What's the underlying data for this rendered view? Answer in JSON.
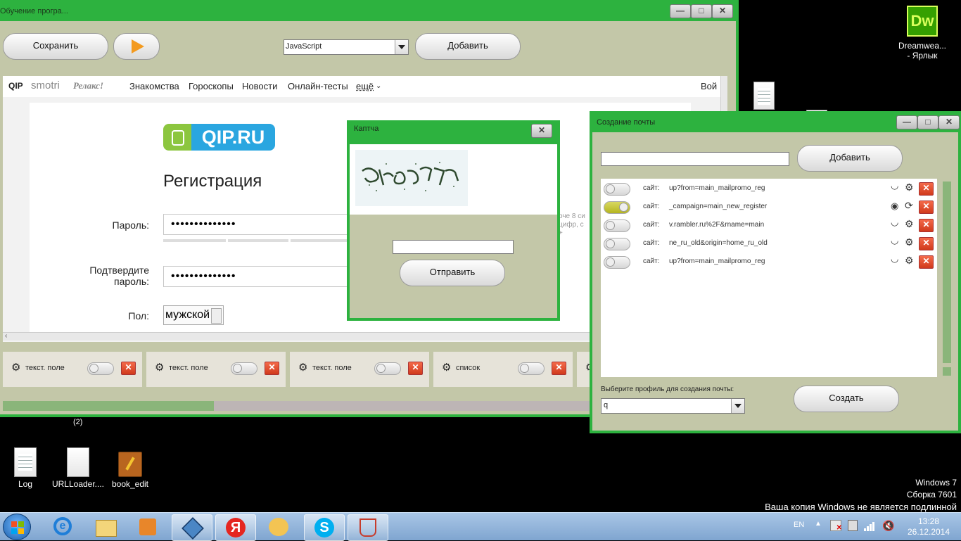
{
  "desktop": {
    "icons": [
      {
        "label": "Log"
      },
      {
        "label": "URLLoader...."
      },
      {
        "label": "book_edit"
      },
      {
        "label": "Dreamwea...\n- Ярлык",
        "logo": "Dw"
      }
    ],
    "counter": "(2)",
    "watermark": {
      "line1": "Windows 7",
      "line2": "Сборка 7601",
      "line3": "Ваша копия Windows не является подлинной"
    }
  },
  "main_window": {
    "title": "Обучение програ...",
    "save_label": "Сохранить",
    "language_select": "JavaScript",
    "add_label": "Добавить",
    "progress": 0.29
  },
  "browser": {
    "nav": {
      "brand1": "QIP",
      "brand2": "smotri",
      "brand3": "Релакс!",
      "links": [
        "Знакомства",
        "Гороскопы",
        "Новости",
        "Онлайн-тесты",
        "ещё"
      ],
      "login": "Вой"
    },
    "logo_text": "QIP.RU",
    "heading": "Регистрация",
    "password_label": "Пароль:",
    "password_value": "••••••••••••••",
    "confirm_label_1": "Подтвердите",
    "confirm_label_2": "пароль:",
    "confirm_value": "••••••••••••••",
    "gender_label": "Пол:",
    "gender_value": "мужской",
    "hint_1": "оче 8 си",
    "hint_2": "цифр, с",
    "hint_3": "+"
  },
  "fields_panel": [
    {
      "label": "текст. поле"
    },
    {
      "label": "текст. поле"
    },
    {
      "label": "текст. поле"
    },
    {
      "label": "список"
    }
  ],
  "captcha": {
    "title": "Каптча",
    "submit_label": "Отправить"
  },
  "mail_window": {
    "title": "Создание почты",
    "add_label": "Добавить",
    "rows": [
      {
        "prefix": "сайт:",
        "url": "up?from=main_mailpromo_reg",
        "enabled": false
      },
      {
        "prefix": "сайт:",
        "url": "_campaign=main_new_register",
        "enabled": true
      },
      {
        "prefix": "сайт:",
        "url": "v.rambler.ru%2F&rname=main",
        "enabled": false
      },
      {
        "prefix": "сайт:",
        "url": "ne_ru_old&origin=home_ru_old",
        "enabled": false
      },
      {
        "prefix": "сайт:",
        "url": "up?from=main_mailpromo_reg",
        "enabled": false
      }
    ],
    "profile_label": "Выберите профиль для создания почты:",
    "profile_value": "q",
    "create_label": "Создать"
  },
  "taskbar": {
    "lang": "EN",
    "time": "13:28",
    "date": "26.12.2014"
  }
}
